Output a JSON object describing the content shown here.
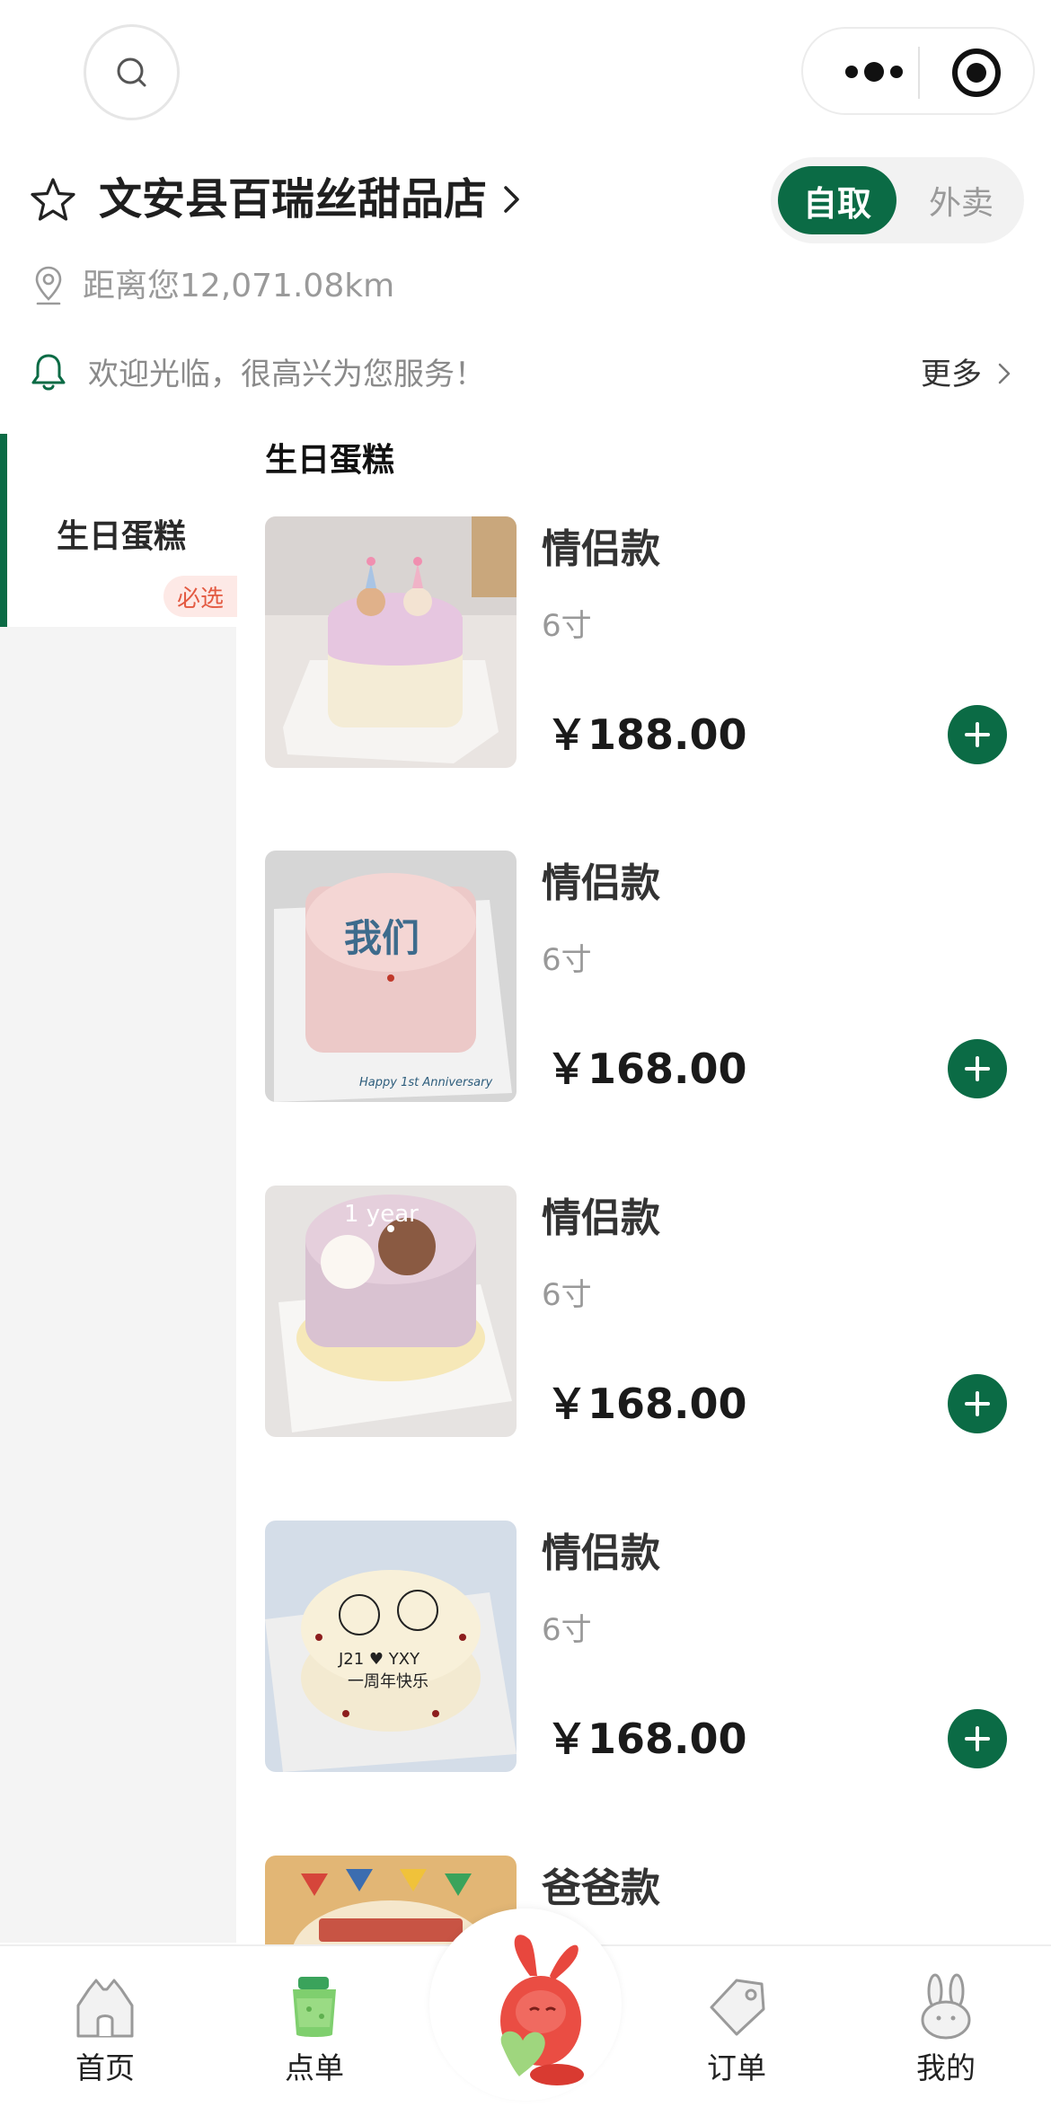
{
  "store": {
    "name": "文安县百瑞丝甜品店",
    "distance": "距离您12,071.08km",
    "welcome": "欢迎光临，很高兴为您服务！",
    "more_label": "更多"
  },
  "mode_toggle": {
    "pickup": "自取",
    "delivery": "外卖",
    "active": "自取"
  },
  "sidebar": {
    "items": [
      {
        "label": "生日蛋糕",
        "badge": "必选"
      }
    ]
  },
  "section": {
    "title": "生日蛋糕"
  },
  "products": [
    {
      "name": "情侣款",
      "size": "6寸",
      "price": "￥188.00"
    },
    {
      "name": "情侣款",
      "size": "6寸",
      "price": "￥168.00"
    },
    {
      "name": "情侣款",
      "size": "6寸",
      "price": "￥168.00"
    },
    {
      "name": "情侣款",
      "size": "6寸",
      "price": "￥168.00"
    },
    {
      "name": "爸爸款"
    }
  ],
  "tabbar": {
    "items": [
      {
        "label": "首页",
        "icon": "house-icon"
      },
      {
        "label": "点单",
        "icon": "cup-icon"
      },
      {
        "label": "",
        "icon": "mascot-icon"
      },
      {
        "label": "订单",
        "icon": "tag-icon"
      },
      {
        "label": "我的",
        "icon": "rabbit-icon"
      }
    ]
  },
  "colors": {
    "brand_green": "#0b6b45",
    "badge_bg": "#fde9e6",
    "badge_text": "#e35a42",
    "sidebar_bg": "#f4f4f4"
  }
}
